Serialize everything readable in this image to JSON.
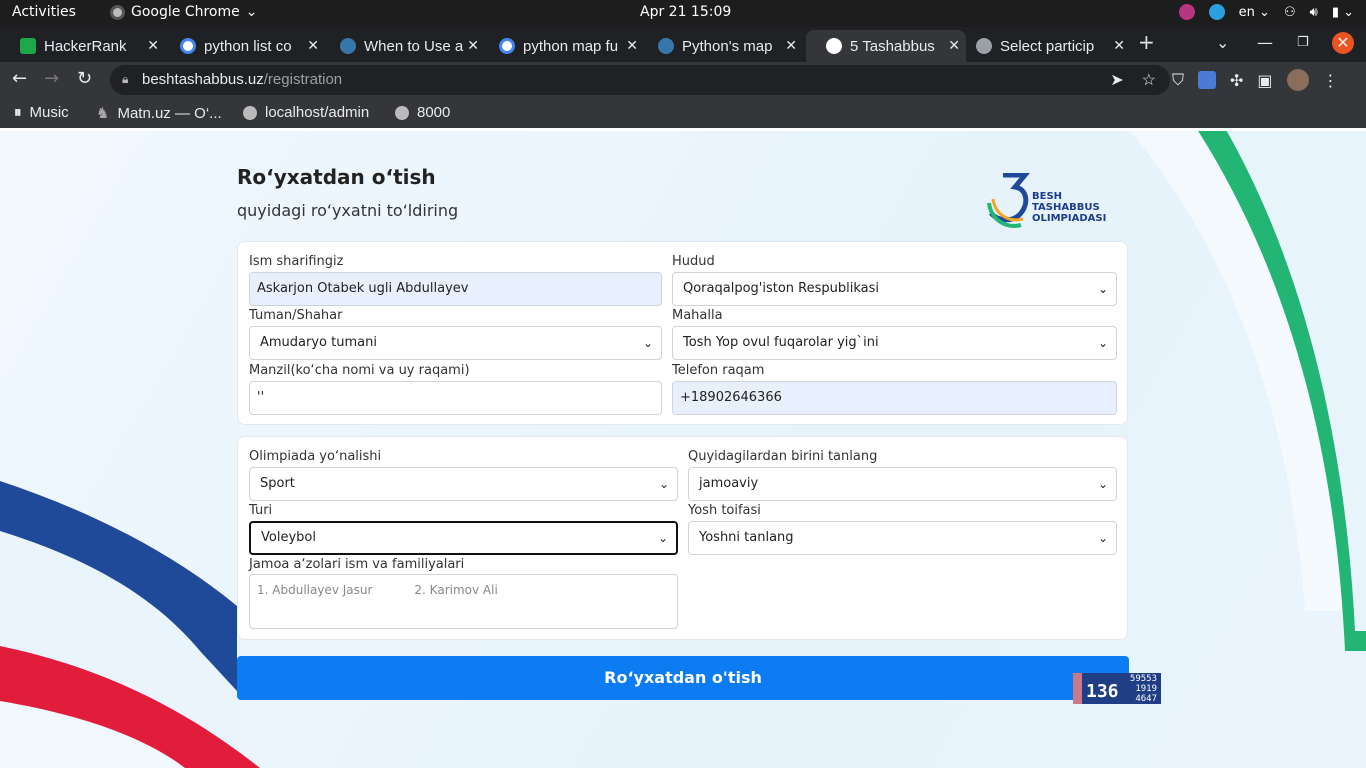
{
  "system_bar": {
    "activities": "Activities",
    "app_name": "Google Chrome",
    "clock": "Apr 21  15:09",
    "language": "en"
  },
  "tabs": [
    {
      "title": "HackerRank",
      "icon": "hackerrank-icon",
      "color": "#1ba94c"
    },
    {
      "title": "python list co",
      "icon": "google-icon",
      "color": "#4285f4"
    },
    {
      "title": "When to Use a",
      "icon": "python-icon",
      "color": "#3776ab"
    },
    {
      "title": "python map fu",
      "icon": "google-icon",
      "color": "#4285f4"
    },
    {
      "title": "Python's map",
      "icon": "python-icon",
      "color": "#3776ab"
    },
    {
      "title": "5 Tashabbus",
      "icon": "tashabbus-icon",
      "color": "#ffffff"
    },
    {
      "title": "Select particip",
      "icon": "globe-icon",
      "color": "#9aa0a6"
    }
  ],
  "address_bar": {
    "domain": "beshtashabbus.uz",
    "path": "/registration"
  },
  "bookmarks": [
    {
      "label": "Music",
      "icon": "music-icon"
    },
    {
      "label": "Matn.uz — O‘...",
      "icon": "matn-icon"
    },
    {
      "label": "localhost/admin",
      "icon": "globe-icon"
    },
    {
      "label": "8000",
      "icon": "globe-icon"
    }
  ],
  "page": {
    "heading": "Ro‘yxatdan o‘tish",
    "subheading": "quyidagi ro‘yxatni to‘ldiring",
    "logo_lines": [
      "BESH",
      "TASHABBUS",
      "OLIMPIADASI"
    ],
    "form1": {
      "name_label": "Ism sharifingiz",
      "name_value": "Askarjon Otabek ugli Abdullayev",
      "region_label": "Hudud",
      "region_value": "Qoraqalpog'iston Respublikasi",
      "district_label": "Tuman/Shahar",
      "district_value": "Amudaryo tumani",
      "mahalla_label": "Mahalla",
      "mahalla_value": "Tosh Yop ovul fuqarolar yig`ini",
      "address_label": "Manzil(ko‘cha nomi va uy raqami)",
      "address_value": "''",
      "phone_label": "Telefon raqam",
      "phone_value": "+18902646366"
    },
    "form2": {
      "direction_label": "Olimpiada yo‘nalishi",
      "direction_value": "Sport",
      "choose_label": "Quyidagilardan birini tanlang",
      "choose_value": "jamoaviy",
      "type_label": "Turi",
      "type_value": "Voleybol",
      "age_label": "Yosh toifasi",
      "age_value": "Yoshni tanlang",
      "team_label": "Jamoa a‘zolari ism va familiyalari",
      "team_placeholder_1": "1. Abdullayev Jasur",
      "team_placeholder_2": "2. Karimov Ali"
    },
    "submit_label": "Ro‘yxatdan o'tish",
    "counter": {
      "big": "136",
      "line1": "59553",
      "line2": "1919",
      "line3": "4647"
    }
  }
}
